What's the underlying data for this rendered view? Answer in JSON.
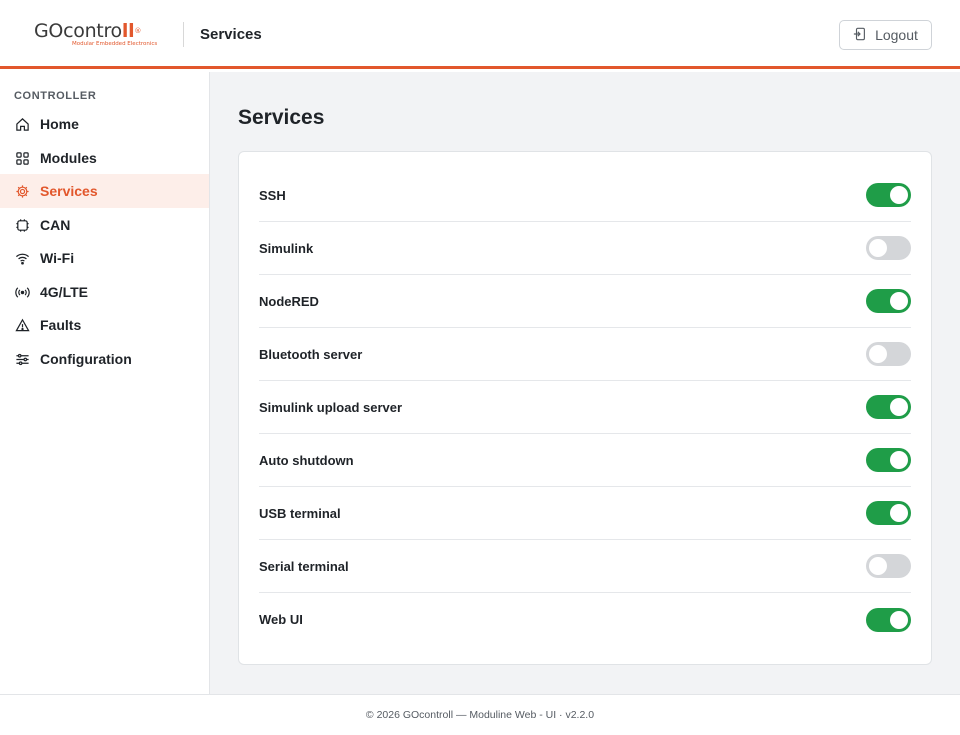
{
  "header": {
    "logo_text_go": "GO",
    "logo_text_contro": "contro",
    "logo_text_ll": "ll",
    "logo_reg": "®",
    "logo_tagline": "Modular Embedded Electronics",
    "title": "Services",
    "logout_label": "Logout",
    "logout_icon": "logout-icon"
  },
  "sidebar": {
    "section_label": "CONTROLLER",
    "items": [
      {
        "label": "Home",
        "icon": "home-icon",
        "active": false
      },
      {
        "label": "Modules",
        "icon": "modules-icon",
        "active": false
      },
      {
        "label": "Services",
        "icon": "gear-icon",
        "active": true
      },
      {
        "label": "CAN",
        "icon": "chip-icon",
        "active": false
      },
      {
        "label": "Wi-Fi",
        "icon": "wifi-icon",
        "active": false
      },
      {
        "label": "4G/LTE",
        "icon": "antenna-icon",
        "active": false
      },
      {
        "label": "Faults",
        "icon": "warning-icon",
        "active": false
      },
      {
        "label": "Configuration",
        "icon": "sliders-icon",
        "active": false
      }
    ]
  },
  "main": {
    "title": "Services",
    "services": [
      {
        "label": "SSH",
        "enabled": true
      },
      {
        "label": "Simulink",
        "enabled": false
      },
      {
        "label": "NodeRED",
        "enabled": true
      },
      {
        "label": "Bluetooth server",
        "enabled": false
      },
      {
        "label": "Simulink upload server",
        "enabled": true
      },
      {
        "label": "Auto shutdown",
        "enabled": true
      },
      {
        "label": "USB terminal",
        "enabled": true
      },
      {
        "label": "Serial terminal",
        "enabled": false
      },
      {
        "label": "Web UI",
        "enabled": true
      }
    ]
  },
  "footer": {
    "text": "© 2026 GOcontroll — Moduline Web - UI · v2.2.0"
  },
  "colors": {
    "accent": "#e2572c",
    "toggle_on": "#1f9d48",
    "toggle_off": "#d4d6d9",
    "active_bg": "#fdeee9"
  }
}
